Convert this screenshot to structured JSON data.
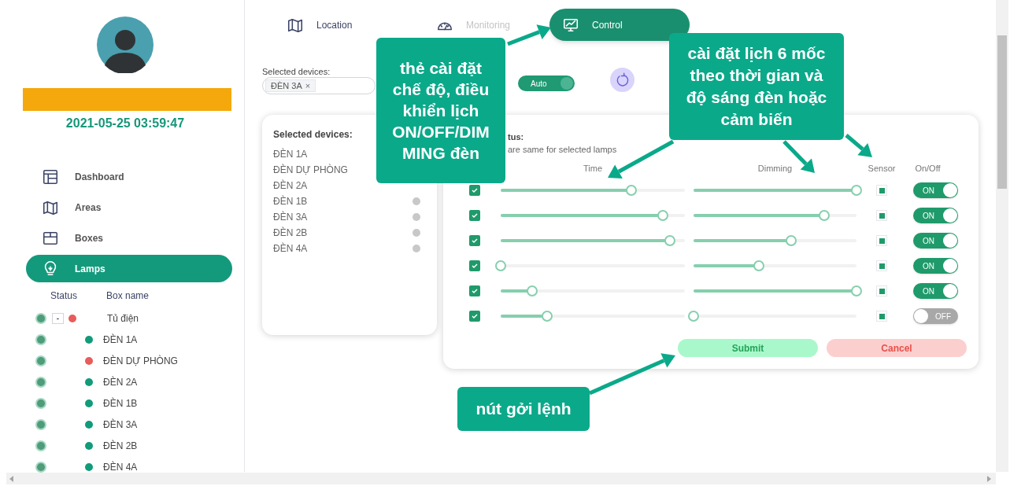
{
  "sidebar": {
    "date_time": "2021-05-25 03:59:47",
    "nav": [
      {
        "label": "Dashboard",
        "selected": false
      },
      {
        "label": "Areas",
        "selected": false
      },
      {
        "label": "Boxes",
        "selected": false
      },
      {
        "label": "Lamps",
        "selected": true
      }
    ],
    "tree": {
      "columns": [
        "Status",
        "Box name"
      ],
      "rows": [
        {
          "name": "Tủ điện",
          "selected": true,
          "toggle": "-",
          "expanded": true,
          "color": "#e85c5c",
          "children": [
            {
              "name": "ĐÈN 1A",
              "selected": true,
              "color": "#119b7a"
            },
            {
              "name": "ĐÈN DỰ PHÒNG",
              "selected": true,
              "color": "#e85c5c"
            },
            {
              "name": "ĐÈN 2A",
              "selected": true,
              "color": "#119b7a"
            },
            {
              "name": "ĐÈN 1B",
              "selected": true,
              "color": "#119b7a"
            },
            {
              "name": "ĐÈN 3A",
              "selected": true,
              "color": "#119b7a"
            },
            {
              "name": "ĐÈN 2B",
              "selected": true,
              "color": "#119b7a"
            },
            {
              "name": "ĐÈN 4A",
              "selected": true,
              "color": "#119b7a"
            }
          ]
        }
      ]
    }
  },
  "tabs": [
    {
      "label": "Location",
      "selected": false,
      "disabled": false
    },
    {
      "label": "Monitoring",
      "selected": false,
      "disabled": true
    },
    {
      "label": "Control",
      "selected": true,
      "disabled": false
    }
  ],
  "selected_devices_field": {
    "label": "Selected devices:",
    "chips": [
      {
        "label": "ĐÈN 3A",
        "remove": "×"
      }
    ]
  },
  "mode_toggle": {
    "label": "Auto",
    "on": true
  },
  "devices_card": {
    "title": "Selected devices:",
    "items": [
      {
        "name": "ĐÈN 1A",
        "dot": false
      },
      {
        "name": "ĐÈN DỰ PHÒNG",
        "dot": false
      },
      {
        "name": "ĐÈN 2A",
        "dot": false
      },
      {
        "name": "ĐÈN 1B",
        "dot": true
      },
      {
        "name": "ĐÈN 3A",
        "dot": true
      },
      {
        "name": "ĐÈN 2B",
        "dot": true
      },
      {
        "name": "ĐÈN 4A",
        "dot": true
      }
    ]
  },
  "schedule": {
    "status_label": "tus:",
    "note": "are same for selected lamps",
    "columns": [
      "Time",
      "Dimming",
      "Sensor",
      "On/Off"
    ],
    "rows": [
      {
        "checked": true,
        "time": {
          "level": 0.71
        },
        "dimming": {
          "level": 1
        },
        "sensor": true,
        "on": true,
        "switch_label": "ON"
      },
      {
        "checked": true,
        "time": {
          "level": 0.88
        },
        "dimming": {
          "level": 0.8
        },
        "sensor": true,
        "on": true,
        "switch_label": "ON"
      },
      {
        "checked": true,
        "time": {
          "level": 0.92
        },
        "dimming": {
          "level": 0.6
        },
        "sensor": true,
        "on": true,
        "switch_label": "ON"
      },
      {
        "checked": true,
        "time": {
          "level": 0
        },
        "dimming": {
          "level": 0.4
        },
        "sensor": true,
        "on": true,
        "switch_label": "ON"
      },
      {
        "checked": true,
        "time": {
          "level": 0.17
        },
        "dimming": {
          "level": 1
        },
        "sensor": true,
        "on": true,
        "switch_label": "ON"
      },
      {
        "checked": true,
        "time": {
          "level": 0.25
        },
        "dimming": {
          "level": 0
        },
        "sensor": true,
        "on": false,
        "switch_label": "OFF"
      }
    ]
  },
  "buttons": [
    {
      "label": "Submit",
      "kind": "submit"
    },
    {
      "label": "Cancel",
      "kind": "cancel"
    }
  ],
  "annotations": [
    {
      "text": "thẻ cài đặt chế độ, điều khiển lịch ON/OFF/DIMMING đèn"
    },
    {
      "text": "cài đặt lịch 6 mốc theo thời gian và độ sáng đèn hoặc cảm biến"
    },
    {
      "text": "nút gởi lệnh"
    }
  ]
}
